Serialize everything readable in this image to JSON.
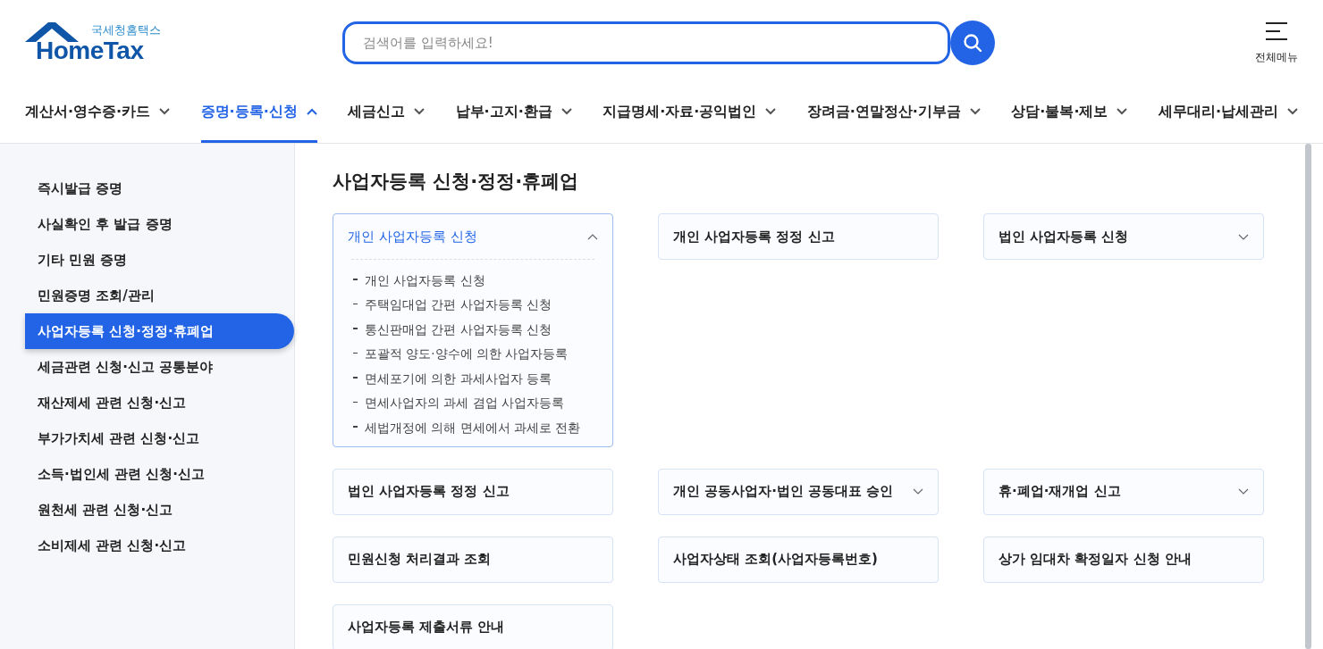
{
  "logo": {
    "subtitle": "국세청홈택스",
    "title": "HomeTax"
  },
  "search": {
    "placeholder": "검색어를 입력하세요!"
  },
  "menu_button": {
    "label": "전체메뉴"
  },
  "nav": [
    {
      "label": "계산서·영수증·카드",
      "selected": false
    },
    {
      "label": "증명·등록·신청",
      "selected": true
    },
    {
      "label": "세금신고",
      "selected": false
    },
    {
      "label": "납부·고지·환급",
      "selected": false
    },
    {
      "label": "지급명세·자료·공익법인",
      "selected": false
    },
    {
      "label": "장려금·연말정산·기부금",
      "selected": false
    },
    {
      "label": "상담·불복·제보",
      "selected": false
    },
    {
      "label": "세무대리·납세관리",
      "selected": false
    }
  ],
  "sidebar": {
    "items": [
      {
        "label": "즉시발급 증명",
        "selected": false
      },
      {
        "label": "사실확인 후 발급 증명",
        "selected": false
      },
      {
        "label": "기타 민원 증명",
        "selected": false
      },
      {
        "label": "민원증명 조회/관리",
        "selected": false
      },
      {
        "label": "사업자등록 신청·정정·휴폐업",
        "selected": true
      },
      {
        "label": "세금관련 신청·신고 공통분야",
        "selected": false
      },
      {
        "label": "재산제세 관련 신청·신고",
        "selected": false
      },
      {
        "label": "부가가치세 관련 신청·신고",
        "selected": false
      },
      {
        "label": "소득·법인세 관련 신청·신고",
        "selected": false
      },
      {
        "label": "원천세 관련 신청·신고",
        "selected": false
      },
      {
        "label": "소비제세 관련 신청·신고",
        "selected": false
      }
    ]
  },
  "page_title": "사업자등록 신청·정정·휴폐업",
  "cards": [
    {
      "title": "개인 사업자등록 신청",
      "kind": "expandable",
      "expanded": true,
      "items": [
        "개인 사업자등록 신청",
        "주택임대업 간편 사업자등록 신청",
        "통신판매업 간편 사업자등록 신청",
        "포괄적 양도·양수에 의한 사업자등록",
        "면세포기에 의한 과세사업자 등록",
        "면세사업자의 과세 겸업 사업자등록",
        "세법개정에 의해 면세에서 과세로 전환"
      ]
    },
    {
      "title": "개인 사업자등록 정정 신고",
      "kind": "link"
    },
    {
      "title": "법인 사업자등록 신청",
      "kind": "expandable",
      "expanded": false
    },
    {
      "title": "법인 사업자등록 정정 신고",
      "kind": "link"
    },
    {
      "title": "개인 공동사업자·법인 공동대표 승인",
      "kind": "expandable",
      "expanded": false
    },
    {
      "title": "휴·폐업·재개업 신고",
      "kind": "expandable",
      "expanded": false
    },
    {
      "title": "민원신청 처리결과 조회",
      "kind": "link"
    },
    {
      "title": "사업자상태 조회(사업자등록번호)",
      "kind": "link"
    },
    {
      "title": "상가 임대차 확정일자 신청 안내",
      "kind": "link"
    },
    {
      "title": "사업자등록 제출서류 안내",
      "kind": "link"
    }
  ]
}
